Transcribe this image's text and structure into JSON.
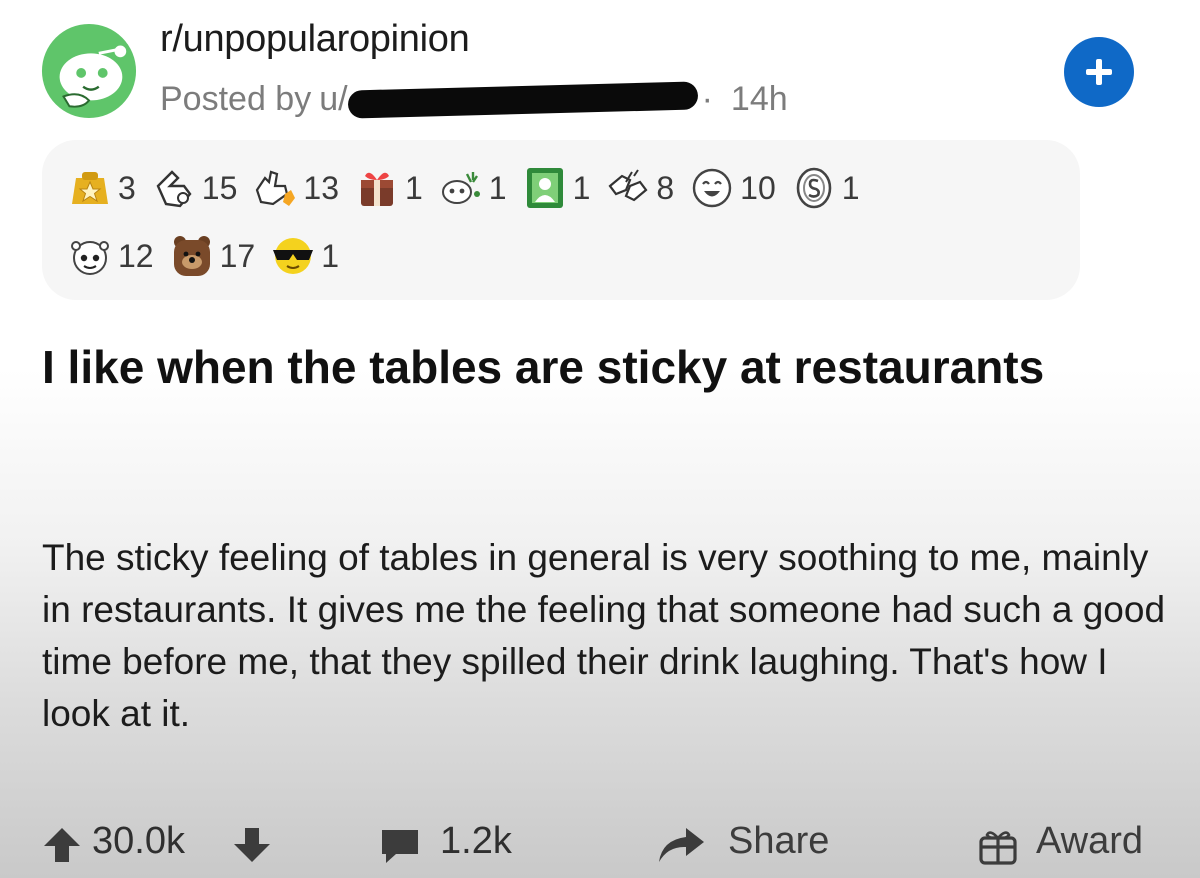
{
  "header": {
    "subreddit": "r/unpopularopinion",
    "posted_by_label": "Posted by",
    "username_visible_prefix": "u/",
    "time_separator": "·",
    "time_ago": "14h"
  },
  "awards": {
    "row1": [
      {
        "icon": "gold-star-award-icon",
        "count": "3"
      },
      {
        "icon": "wholesome-hug-award-icon",
        "count": "15"
      },
      {
        "icon": "helpful-thumbs-up-award-icon",
        "count": "13"
      },
      {
        "icon": "gift-box-award-icon",
        "count": "1"
      },
      {
        "icon": "snoo-party-award-icon",
        "count": "1"
      },
      {
        "icon": "green-portrait-award-icon",
        "count": "1"
      },
      {
        "icon": "fist-bump-award-icon",
        "count": "8"
      },
      {
        "icon": "laughing-face-award-icon",
        "count": "10"
      },
      {
        "icon": "silver-coin-award-icon",
        "count": "1"
      }
    ],
    "row2": [
      {
        "icon": "snoo-face-award-icon",
        "count": "12"
      },
      {
        "icon": "brown-bear-award-icon",
        "count": "17"
      },
      {
        "icon": "cool-sunglasses-award-icon",
        "count": "1"
      }
    ]
  },
  "post": {
    "title": "I like when the tables are sticky at restaurants",
    "body": "The sticky feeling of tables in general is very soothing to me, mainly in restaurants. It gives me the feeling that someone had such a good time before me, that they spilled their drink laughing. That's how I look at it."
  },
  "actions": {
    "vote_count": "30.0k",
    "comment_count": "1.2k",
    "share_label": "Share",
    "award_label": "Award"
  },
  "colors": {
    "join_button": "#0f69c7",
    "avatar_green": "#5fc56a",
    "text_primary": "#1c1c1c",
    "text_secondary": "#7c7c7c"
  }
}
